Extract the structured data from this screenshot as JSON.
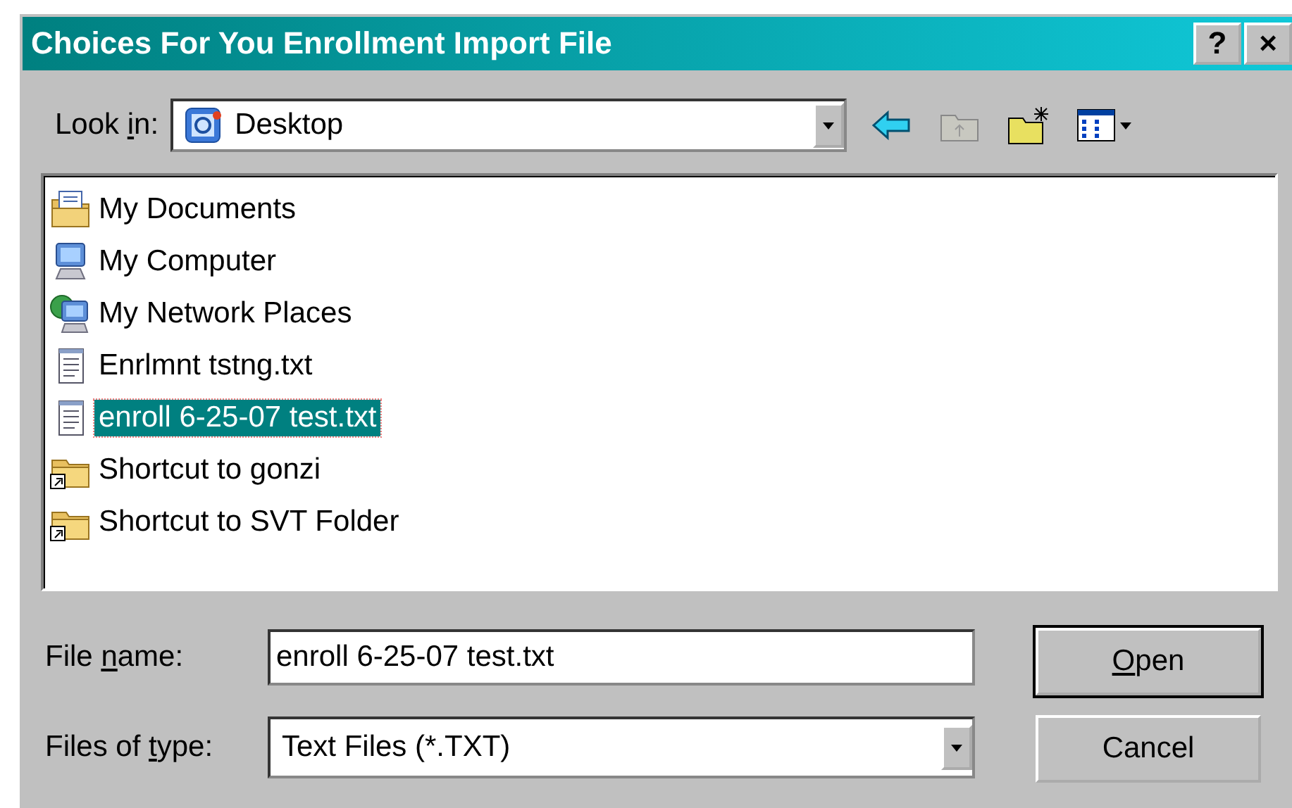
{
  "window": {
    "title": "Choices For You Enrollment Import File",
    "title_buttons": [
      "?",
      "×"
    ]
  },
  "look_in": {
    "label": {
      "before": "Look ",
      "key": "i",
      "after": "n:"
    },
    "value": "Desktop"
  },
  "files": [
    {
      "name": "My Documents",
      "kind": "documents",
      "selected": false
    },
    {
      "name": "My Computer",
      "kind": "computer",
      "selected": false
    },
    {
      "name": "My Network Places",
      "kind": "network",
      "selected": false
    },
    {
      "name": "Enrlmnt tstng.txt",
      "kind": "text",
      "selected": false
    },
    {
      "name": "enroll 6-25-07 test.txt",
      "kind": "text",
      "selected": true
    },
    {
      "name": "Shortcut to gonzi",
      "kind": "shortcut",
      "selected": false
    },
    {
      "name": "Shortcut to SVT Folder",
      "kind": "shortcut",
      "selected": false
    }
  ],
  "file_name": {
    "label": {
      "before": "File ",
      "key": "n",
      "after": "ame:"
    },
    "value": "enroll 6-25-07 test.txt"
  },
  "file_type": {
    "label": {
      "before": "Files of ",
      "key": "t",
      "after": "ype:"
    },
    "value": "Text Files (*.TXT)"
  },
  "buttons": [
    {
      "label": {
        "key": "O",
        "after": "pen"
      },
      "default": true
    },
    {
      "label": {
        "before": "Cancel"
      },
      "default": false
    }
  ]
}
